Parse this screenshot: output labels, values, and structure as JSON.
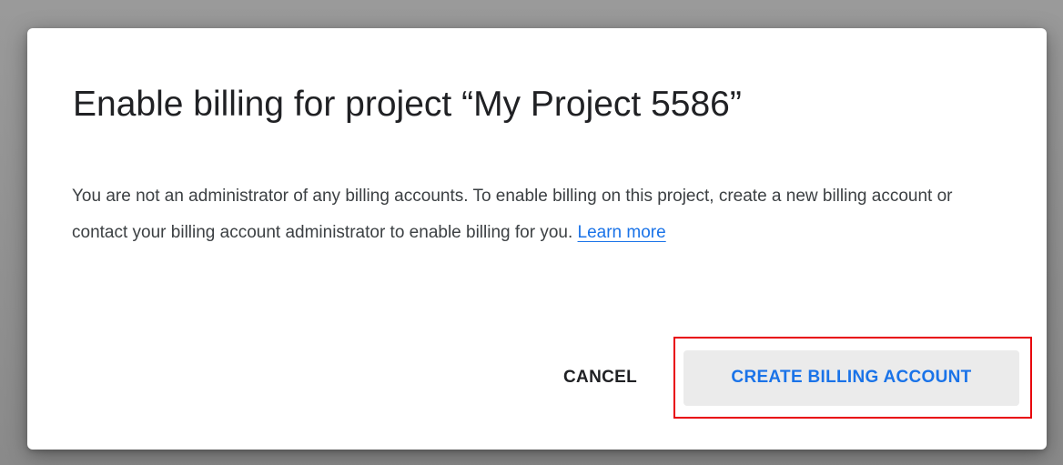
{
  "dialog": {
    "title": "Enable billing for project “My Project 5586”",
    "body_text": "You are not an administrator of any billing accounts. To enable billing on this project, create a new billing account or contact your billing account administrator to enable billing for you.",
    "learn_more_label": "Learn more",
    "cancel_label": "CANCEL",
    "create_label": "CREATE BILLING ACCOUNT"
  },
  "colors": {
    "accent": "#1a73e8",
    "highlight": "#e8000b",
    "text": "#202124"
  }
}
